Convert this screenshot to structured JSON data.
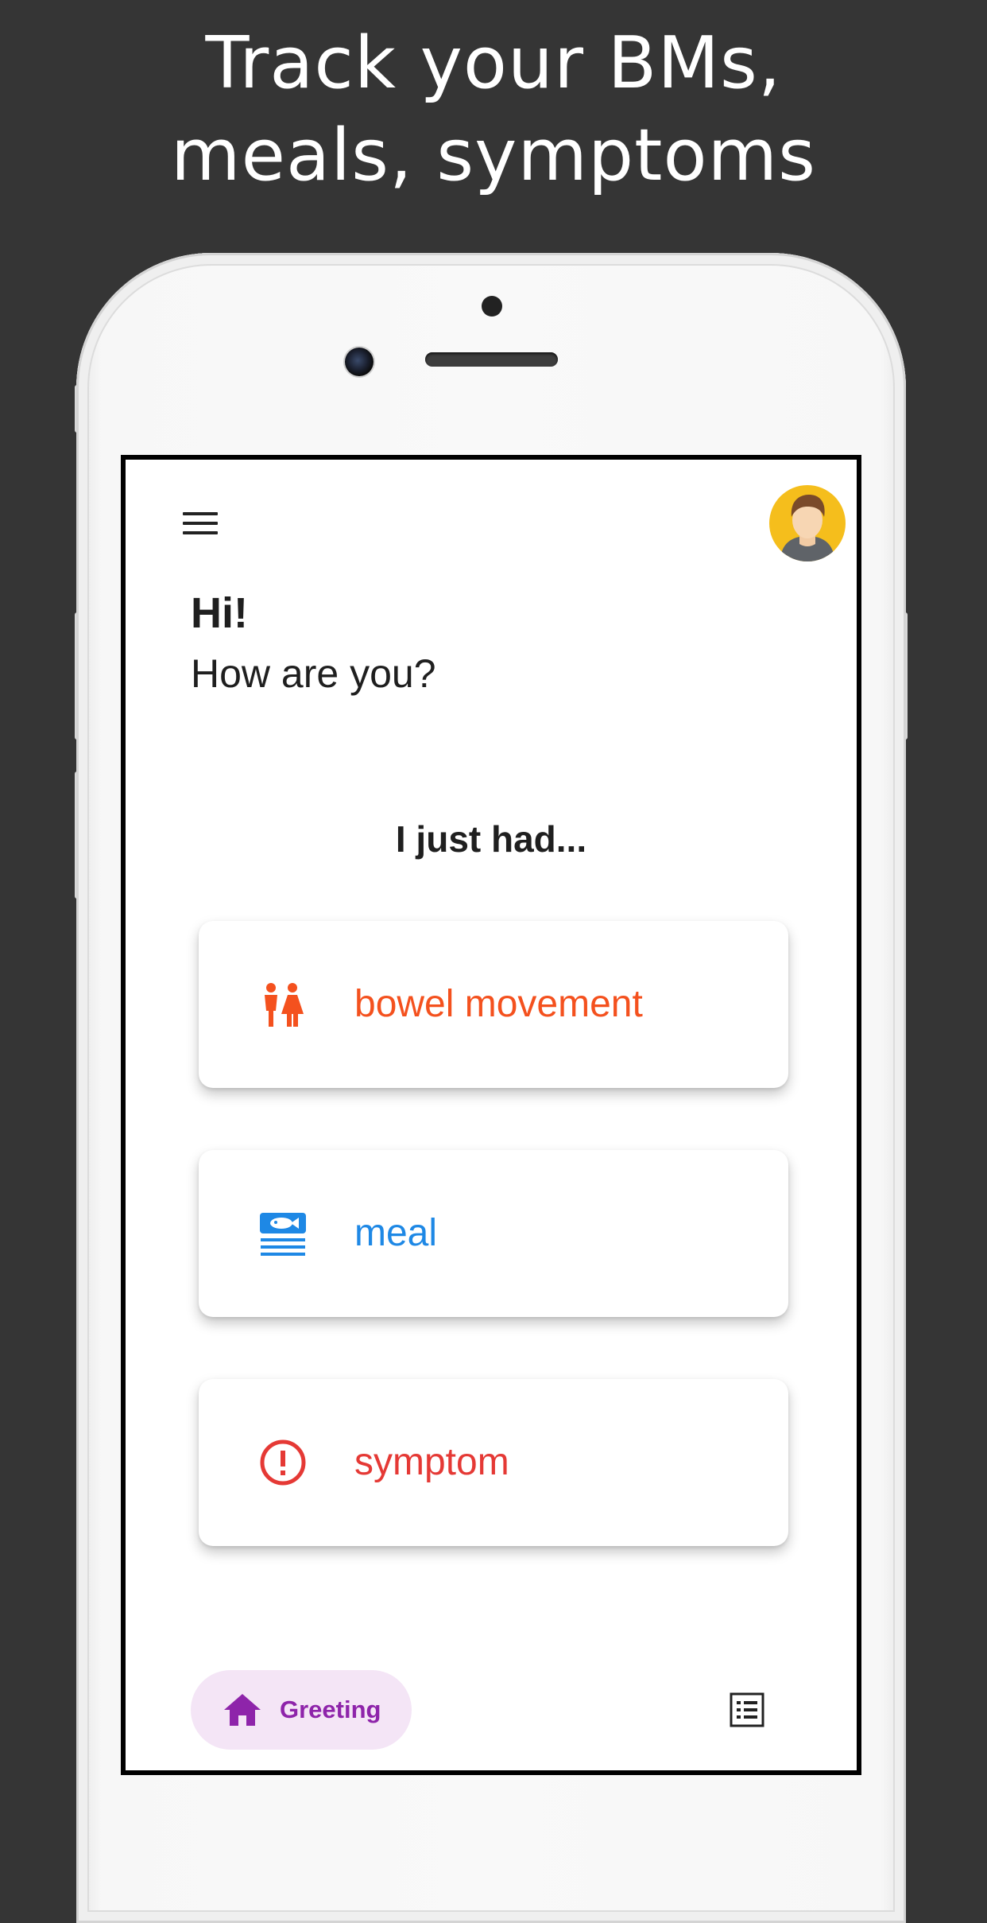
{
  "headline": {
    "line1": "Track your BMs,",
    "line2": "meals, symptoms"
  },
  "greeting": {
    "title": "Hi!",
    "subtitle": "How are you?"
  },
  "prompt": "I just had...",
  "options": [
    {
      "label": "bowel movement",
      "icon": "restroom-icon",
      "color": "#f4511e"
    },
    {
      "label": "meal",
      "icon": "meal-icon",
      "color": "#1e88e5"
    },
    {
      "label": "symptom",
      "icon": "alert-circle-icon",
      "color": "#e53935"
    }
  ],
  "bottom_nav": {
    "active_label": "Greeting",
    "active_icon": "home-icon",
    "active_color": "#8e24aa",
    "secondary_icon": "list-icon"
  },
  "avatar": {
    "icon": "user-avatar-icon",
    "background": "#f5be1c"
  }
}
